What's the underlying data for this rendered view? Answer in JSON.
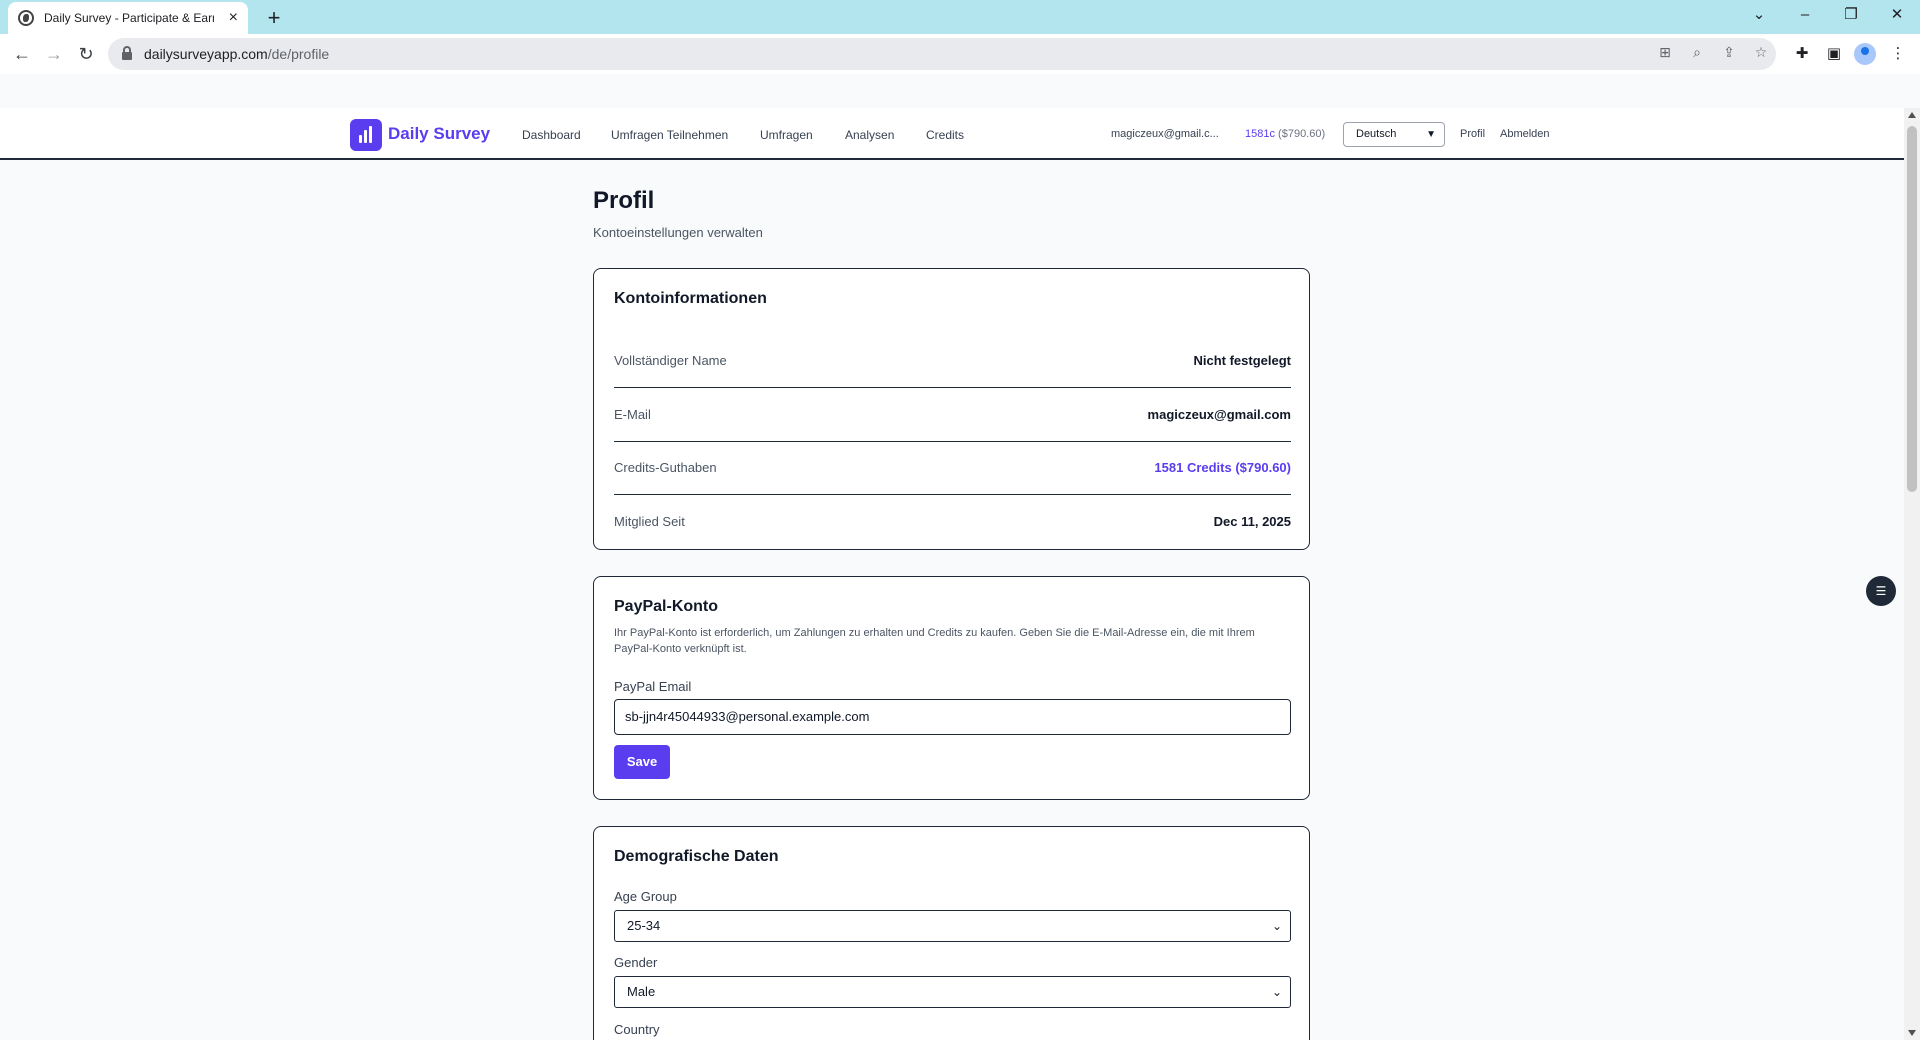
{
  "browser": {
    "tab_title": "Daily Survey - Participate & Earn",
    "url_host": "dailysurveyapp.com",
    "url_path": "/de/profile",
    "new_tab": "+",
    "tab_close": "×"
  },
  "header": {
    "brand": "Daily Survey",
    "nav": [
      "Dashboard",
      "Umfragen Teilnehmen",
      "Umfragen",
      "Analysen",
      "Credits"
    ],
    "user_email": "magiczeux@gmail.c...",
    "credits": "1581c",
    "credits_usd": "($790.60)",
    "language": "Deutsch",
    "profile": "Profil",
    "logout": "Abmelden"
  },
  "page": {
    "title": "Profil",
    "subtitle": "Kontoeinstellungen verwalten"
  },
  "account": {
    "title": "Kontoinformationen",
    "rows": [
      {
        "label": "Vollständiger Name",
        "value": "Nicht festgelegt"
      },
      {
        "label": "E-Mail",
        "value": "magiczeux@gmail.com"
      },
      {
        "label": "Credits-Guthaben",
        "value": "1581 Credits ($790.60)"
      },
      {
        "label": "Mitglied Seit",
        "value": "Dec 11, 2025"
      }
    ]
  },
  "paypal": {
    "title": "PayPal-Konto",
    "description": "Ihr PayPal-Konto ist erforderlich, um Zahlungen zu erhalten und Credits zu kaufen. Geben Sie die E-Mail-Adresse ein, die mit Ihrem PayPal-Konto verknüpft ist.",
    "email_label": "PayPal Email",
    "email_value": "sb-jjn4r45044933@personal.example.com",
    "save_label": "Save"
  },
  "demographics": {
    "title": "Demografische Daten",
    "age_label": "Age Group",
    "age_value": "25-34",
    "gender_label": "Gender",
    "gender_value": "Male",
    "country_label": "Country"
  },
  "colors": {
    "accent": "#5b3df0",
    "border": "#1f2937",
    "page_bg": "#f9fafb",
    "tabbar": "#b3e5ef"
  },
  "icons": [
    "globe-icon",
    "back-arrow-icon",
    "forward-arrow-icon",
    "reload-icon",
    "lock-icon",
    "translate-icon",
    "zoom-icon",
    "share-icon",
    "star-icon",
    "extensions-icon",
    "sidepanel-icon",
    "profile-icon",
    "kebab-menu-icon",
    "chevron-down-icon",
    "minimize-icon",
    "restore-icon",
    "close-icon",
    "chart-logo-icon",
    "floating-menu-icon"
  ]
}
